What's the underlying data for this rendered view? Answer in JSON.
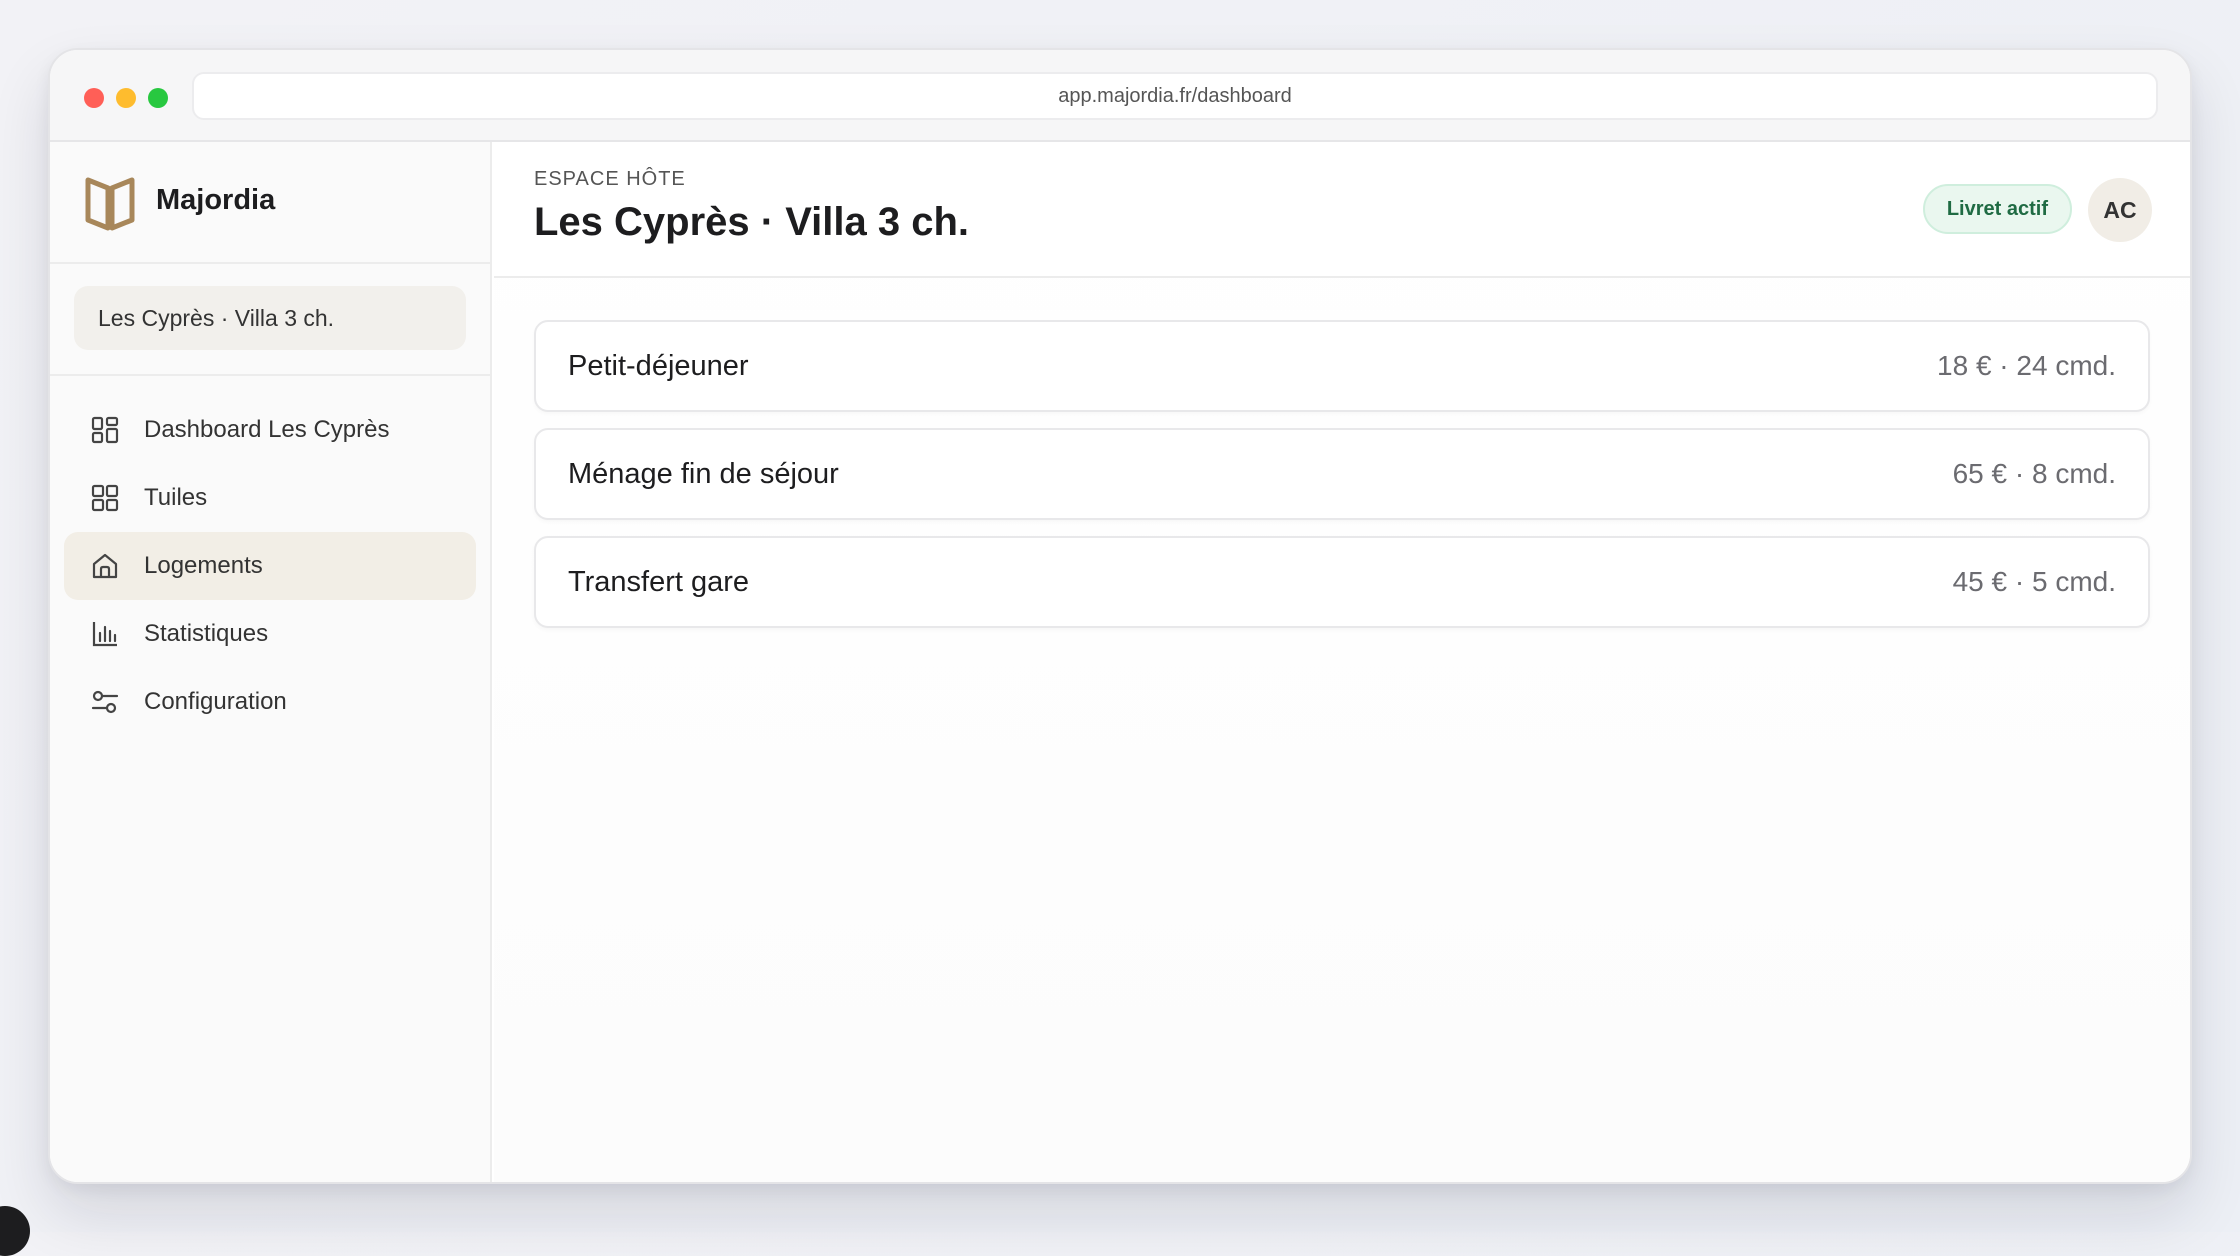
{
  "browser": {
    "url": "app.majordia.fr/dashboard"
  },
  "sidebar": {
    "brand_name": "Majordia",
    "property_name": "Les Cyprès · Villa 3 ch.",
    "items": [
      {
        "label": "Dashboard Les Cyprès",
        "icon": "grid-icon",
        "active": false
      },
      {
        "label": "Tuiles",
        "icon": "tiles-icon",
        "active": false
      },
      {
        "label": "Logements",
        "icon": "house-icon",
        "active": true
      },
      {
        "label": "Statistiques",
        "icon": "bar-chart-icon",
        "active": false
      },
      {
        "label": "Configuration",
        "icon": "sliders-icon",
        "active": false
      }
    ]
  },
  "header": {
    "eyebrow": "ESPACE HÔTE",
    "title": "Les Cyprès · Villa 3 ch.",
    "status_badge": "Livret actif",
    "avatar_initials": "AC"
  },
  "services": [
    {
      "name": "Petit-déjeuner",
      "meta": "18 € · 24 cmd."
    },
    {
      "name": "Ménage fin de séjour",
      "meta": "65 € · 8 cmd."
    },
    {
      "name": "Transfert gare",
      "meta": "45 € · 5 cmd."
    }
  ],
  "colors": {
    "accent": "#a8875a",
    "badge_green": "#1f6b43",
    "active_nav_bg": "#f2eee6"
  }
}
